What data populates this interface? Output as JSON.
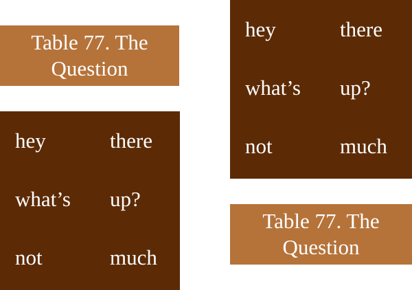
{
  "captions": {
    "left": {
      "line1": "Table 77. The",
      "line2": "Question"
    },
    "right": {
      "line1": "Table 77. The",
      "line2": "Question"
    }
  },
  "tables": {
    "left": {
      "rows": [
        [
          "hey",
          "there"
        ],
        [
          "what’s",
          "up?"
        ],
        [
          "not",
          "much"
        ]
      ]
    },
    "right": {
      "rows": [
        [
          "hey",
          "there"
        ],
        [
          "what’s",
          "up?"
        ],
        [
          "not",
          "much"
        ]
      ]
    }
  },
  "colors": {
    "caption_bg": "#b5733a",
    "table_bg": "#5c2b06",
    "text": "#ffffff"
  }
}
